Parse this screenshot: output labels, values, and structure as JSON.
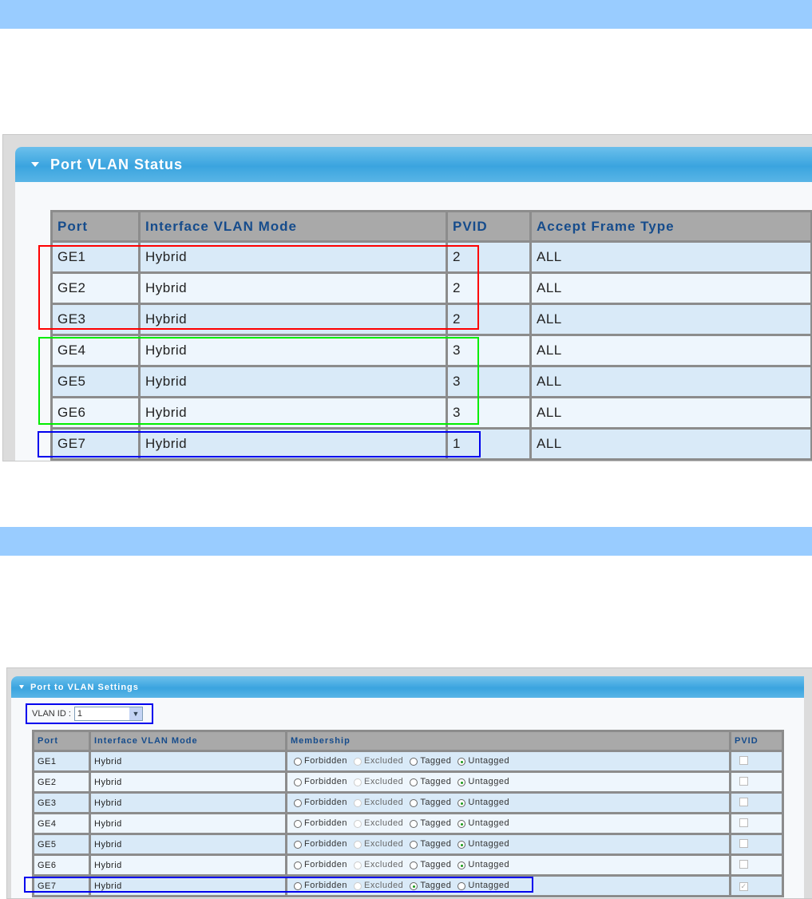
{
  "status": {
    "title": "Port VLAN Status",
    "headers": [
      "Port",
      "Interface VLAN Mode",
      "PVID",
      "Accept Frame Type"
    ],
    "rows": [
      [
        "GE1",
        "Hybrid",
        "2",
        "ALL"
      ],
      [
        "GE2",
        "Hybrid",
        "2",
        "ALL"
      ],
      [
        "GE3",
        "Hybrid",
        "2",
        "ALL"
      ],
      [
        "GE4",
        "Hybrid",
        "3",
        "ALL"
      ],
      [
        "GE5",
        "Hybrid",
        "3",
        "ALL"
      ],
      [
        "GE6",
        "Hybrid",
        "3",
        "ALL"
      ],
      [
        "GE7",
        "Hybrid",
        "1",
        "ALL"
      ]
    ]
  },
  "settings": {
    "title": "Port to VLAN Settings",
    "vlan_label": "VLAN ID :",
    "vlan_value": "1",
    "headers": [
      "Port",
      "Interface VLAN Mode",
      "Membership",
      "PVID"
    ],
    "options": [
      "Forbidden",
      "Excluded",
      "Tagged",
      "Untagged"
    ],
    "rows": [
      {
        "port": "GE1",
        "mode": "Hybrid",
        "membership": "Untagged",
        "pvid": false
      },
      {
        "port": "GE2",
        "mode": "Hybrid",
        "membership": "Untagged",
        "pvid": false
      },
      {
        "port": "GE3",
        "mode": "Hybrid",
        "membership": "Untagged",
        "pvid": false
      },
      {
        "port": "GE4",
        "mode": "Hybrid",
        "membership": "Untagged",
        "pvid": false
      },
      {
        "port": "GE5",
        "mode": "Hybrid",
        "membership": "Untagged",
        "pvid": false
      },
      {
        "port": "GE6",
        "mode": "Hybrid",
        "membership": "Untagged",
        "pvid": false
      },
      {
        "port": "GE7",
        "mode": "Hybrid",
        "membership": "Tagged",
        "pvid": true
      }
    ]
  },
  "highlight_colors": [
    "#ff0000",
    "#00ee00",
    "#0000ee"
  ]
}
